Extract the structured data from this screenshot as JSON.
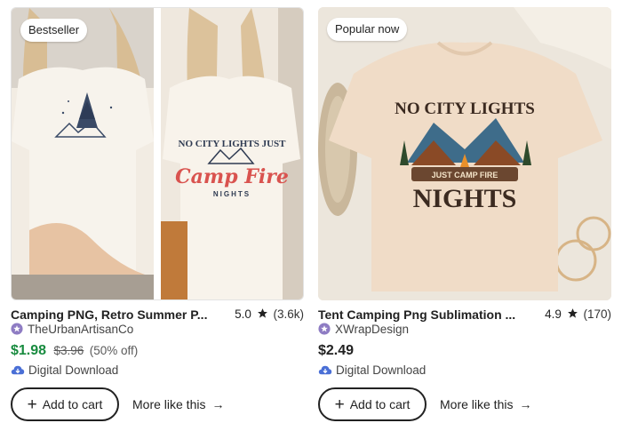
{
  "listings": [
    {
      "badge": "Bestseller",
      "title": "Camping PNG, Retro Summer P...",
      "rating": "5.0",
      "review_count": "(3.6k)",
      "shop": "TheUrbanArtisanCo",
      "price": "$1.98",
      "original_price": "$3.96",
      "discount": "(50% off)",
      "delivery": "Digital Download",
      "add_to_cart": "Add to cart",
      "more_like_this": "More like this",
      "image": {
        "shirt_front_graphic": "tree-mountain-icon",
        "shirt_back_text_top": "NO CITY LIGHTS JUST",
        "shirt_back_text_script": "Camp Fire",
        "shirt_back_text_bottom": "NIGHTS"
      }
    },
    {
      "badge": "Popular now",
      "title": "Tent Camping Png Sublimation ...",
      "rating": "4.9",
      "review_count": "(170)",
      "shop": "XWrapDesign",
      "price": "$2.49",
      "delivery": "Digital Download",
      "add_to_cart": "Add to cart",
      "more_like_this": "More like this",
      "image": {
        "shirt_text_top": "NO CITY LIGHTS",
        "shirt_text_middle": "JUST CAMP FIRE",
        "shirt_text_bottom": "NIGHTS"
      }
    }
  ],
  "colors": {
    "sale_price": "#188b3f",
    "text": "#222222",
    "star": "#222222",
    "shop_badge": "#8e7cc3",
    "cloud_icon": "#4a6fd6",
    "script_red": "#d9534f"
  }
}
